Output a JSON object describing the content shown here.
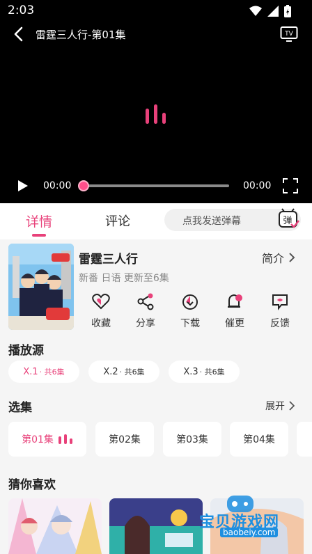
{
  "status_bar": {
    "time": "2:03"
  },
  "player": {
    "title": "雷霆三人行-第01集",
    "current_time": "00:00",
    "total_time": "00:00",
    "progress": 0
  },
  "tabs": {
    "items": [
      {
        "label": "详情",
        "active": true
      },
      {
        "label": "评论",
        "active": false
      }
    ],
    "danmaku_placeholder": "点我发送弹幕",
    "danmaku_icon_text": "弹"
  },
  "anime": {
    "title": "雷霆三人行",
    "intro_label": "简介",
    "meta": "新番 日语 更新至6集",
    "actions": [
      {
        "label": "收藏",
        "icon": "heart-icon"
      },
      {
        "label": "分享",
        "icon": "share-icon"
      },
      {
        "label": "下载",
        "icon": "download-icon"
      },
      {
        "label": "催更",
        "icon": "bell-icon"
      },
      {
        "label": "反馈",
        "icon": "feedback-icon"
      }
    ]
  },
  "sources": {
    "title": "播放源",
    "items": [
      {
        "name": "X.1",
        "sub": "· 共6集",
        "active": true
      },
      {
        "name": "X.2",
        "sub": "· 共6集",
        "active": false
      },
      {
        "name": "X.3",
        "sub": "· 共6集",
        "active": false
      }
    ]
  },
  "episodes": {
    "title": "选集",
    "expand_label": "展开",
    "items": [
      {
        "label": "第01集",
        "active": true
      },
      {
        "label": "第02集",
        "active": false
      },
      {
        "label": "第03集",
        "active": false
      },
      {
        "label": "第04集",
        "active": false
      }
    ]
  },
  "recommend": {
    "title": "猜你喜欢"
  },
  "watermark": {
    "text": "宝贝游戏网",
    "url": "baobeiy.com"
  },
  "colors": {
    "accent": "#e8417a",
    "player_bg": "#000000",
    "page_bg": "#f5f5f5"
  }
}
